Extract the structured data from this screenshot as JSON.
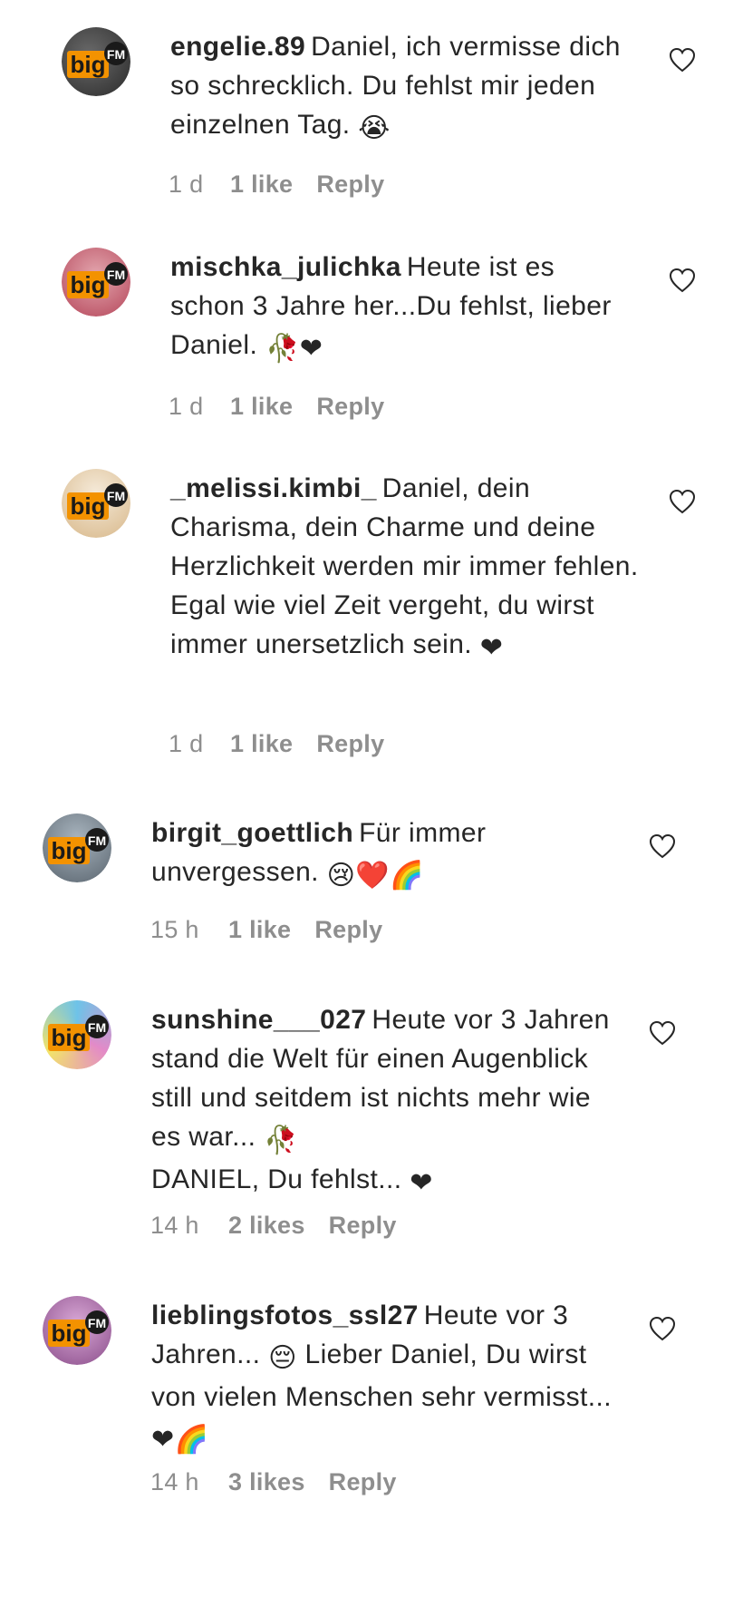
{
  "comments": [
    {
      "username": "engelie.89",
      "text": "Daniel, ich vermisse dich so schrecklich. Du fehlst mir jeden einzelnen Tag.",
      "emoji": "😭",
      "time": "1 d",
      "likes": "1 like",
      "reply": "Reply",
      "avatar_colors": [
        "#2a2a2a",
        "#555555"
      ]
    },
    {
      "username": "mischka_julichka",
      "text": "Heute ist es schon 3 Jahre her...Du fehlst, lieber Daniel.",
      "emoji": "🥀❤",
      "time": "1 d",
      "likes": "1 like",
      "reply": "Reply",
      "avatar_colors": [
        "#b5465a",
        "#e3a6ae"
      ]
    },
    {
      "username": "_melissi.kimbi_",
      "text": "Daniel, dein Charisma, dein Charme und deine Herzlichkeit werden mir immer fehlen. Egal wie viel Zeit vergeht, du wirst immer unersetzlich sein.",
      "emoji": "❤",
      "time": "1 d",
      "likes": "1 like",
      "reply": "Reply",
      "avatar_colors": [
        "#e8cfa8",
        "#f5ead9"
      ]
    },
    {
      "username": "birgit_goettlich",
      "text": "Für immer unvergessen.",
      "emoji": "😢❤️🌈",
      "time": "15 h",
      "likes": "1 like",
      "reply": "Reply",
      "avatar_colors": [
        "#5b6670",
        "#a7b3bd"
      ]
    },
    {
      "username": "sunshine___027",
      "text": "Heute vor 3 Jahren stand die Welt für einen Augenblick still und seitdem ist nichts mehr wie es war...",
      "emoji": "🥀",
      "text2": "DANIEL, Du fehlst...",
      "emoji2": "❤",
      "time": "14 h",
      "likes": "2 likes",
      "reply": "Reply",
      "avatar_colors": [
        "#6ec3e8",
        "#e38ac8"
      ]
    },
    {
      "username": "lieblingsfotos_ssl27",
      "text": "Heute vor 3 Jahren...",
      "emoji": "😔",
      "text2": "Lieber Daniel, Du wirst von vielen Menschen sehr vermisst...",
      "emoji2": "❤🌈",
      "time": "14 h",
      "likes": "3 likes",
      "reply": "Reply",
      "avatar_colors": [
        "#8a4d8a",
        "#d9a8d6"
      ]
    }
  ],
  "colors": {
    "text": "#262626",
    "meta": "#8e8e8e",
    "logo_orange": "#f39200",
    "logo_dark": "#1a1a1a"
  }
}
